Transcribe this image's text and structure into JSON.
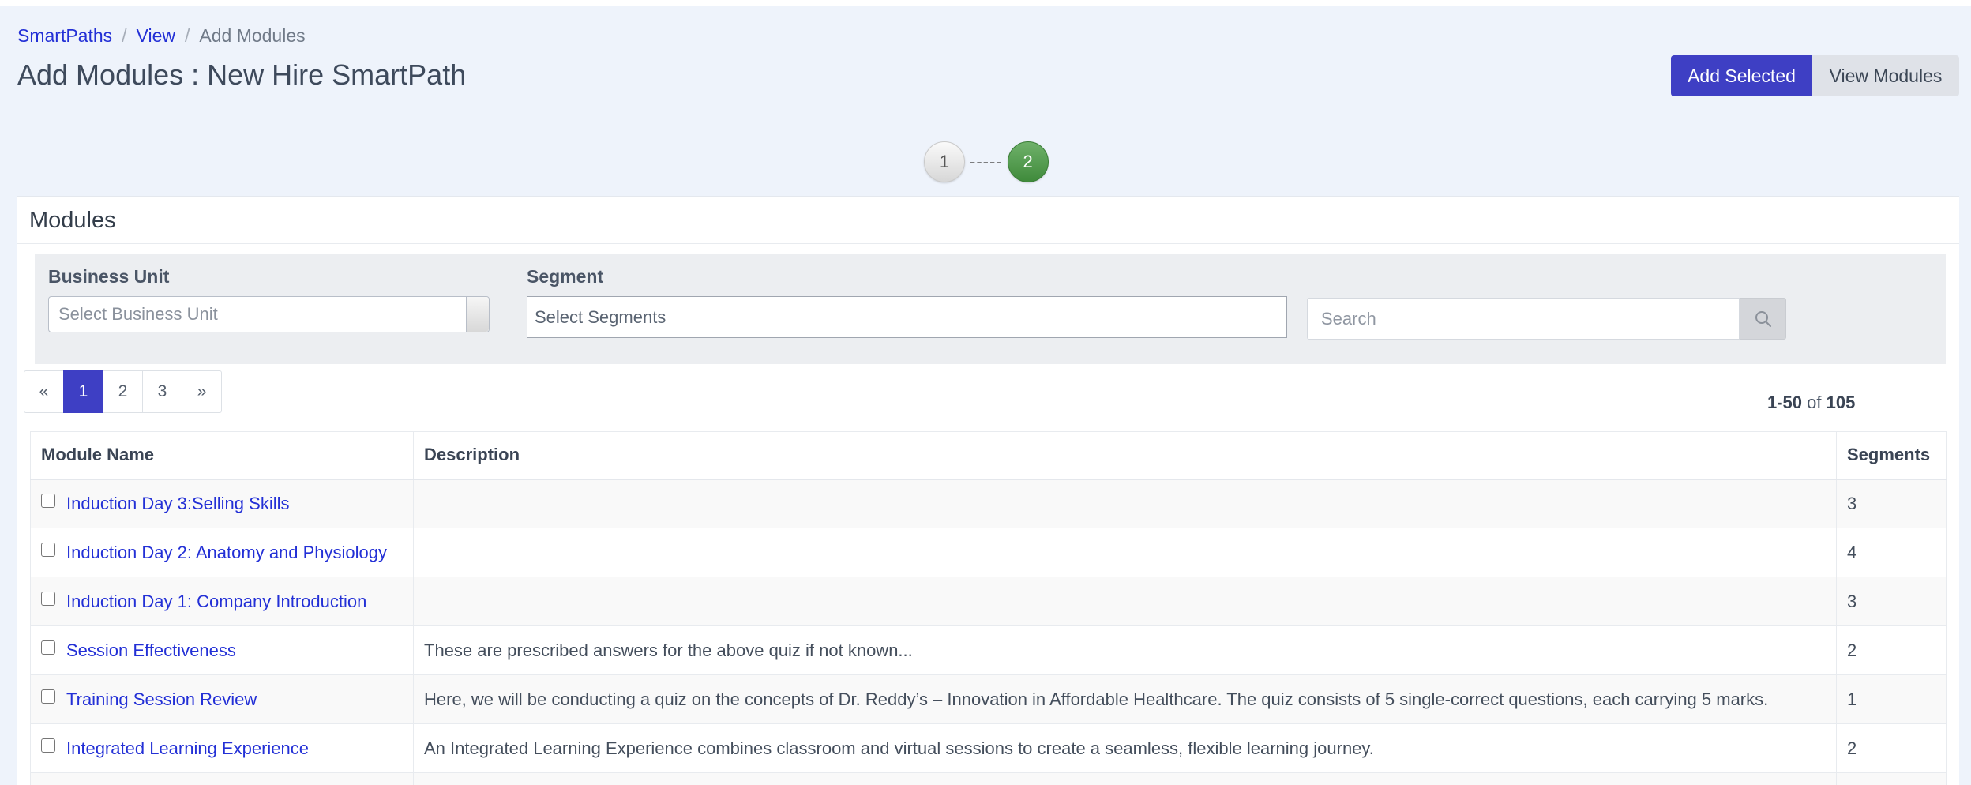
{
  "breadcrumb": {
    "items": [
      "SmartPaths",
      "View"
    ],
    "current": "Add Modules"
  },
  "page": {
    "title": "Add Modules : New Hire SmartPath"
  },
  "actions": {
    "add_selected": "Add Selected",
    "view_modules": "View Modules"
  },
  "stepper": {
    "step1": "1",
    "connector": "-----",
    "step2": "2"
  },
  "panel": {
    "heading": "Modules"
  },
  "filters": {
    "business_unit_label": "Business Unit",
    "business_unit_placeholder": "Select Business Unit",
    "segment_label": "Segment",
    "segment_placeholder": "Select Segments",
    "search_placeholder": "Search"
  },
  "pagination": {
    "prev": "«",
    "pages": [
      "1",
      "2",
      "3"
    ],
    "next": "»",
    "active_page": "1"
  },
  "range": {
    "shown": "1-50",
    "of": "of",
    "total": "105"
  },
  "table": {
    "headers": {
      "module_name": "Module Name",
      "description": "Description",
      "segments": "Segments"
    },
    "rows": [
      {
        "name": "Induction Day 3:Selling Skills",
        "description": "",
        "segments": "3"
      },
      {
        "name": "Induction Day 2: Anatomy and Physiology",
        "description": "",
        "segments": "4"
      },
      {
        "name": "Induction Day 1: Company Introduction",
        "description": "",
        "segments": "3"
      },
      {
        "name": "Session Effectiveness",
        "description": "These are prescribed answers for the above quiz if not known...",
        "segments": "2"
      },
      {
        "name": "Training Session Review",
        "description": "Here, we will be conducting a quiz on the concepts of Dr. Reddy’s – Innovation in Affordable Healthcare. The quiz consists of 5 single-correct questions, each carrying 5 marks.",
        "segments": "1"
      },
      {
        "name": "Integrated Learning Experience",
        "description": "An Integrated Learning Experience combines classroom and virtual sessions to create a seamless, flexible learning journey.",
        "segments": "2"
      },
      {
        "name": "",
        "description": "",
        "segments": ""
      }
    ]
  },
  "colors": {
    "primary": "#3e3fc4",
    "link": "#2330d6",
    "background": "#eef3fb",
    "step_active": "#4f9a4a"
  }
}
